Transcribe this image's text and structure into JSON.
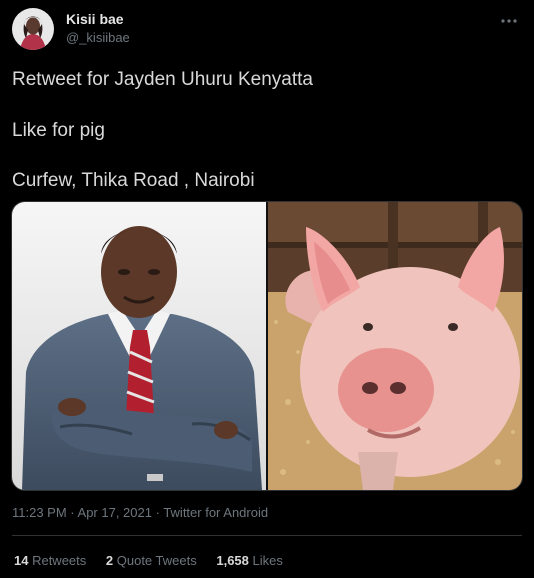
{
  "author": {
    "name": "Kisii bae",
    "handle": "@_kisiibae"
  },
  "menu": {
    "icon": "more-horizontal-icon"
  },
  "content": {
    "line1": "Retweet for Jayden Uhuru Kenyatta",
    "line2": "Like for pig",
    "line3": "Curfew, Thika Road , Nairobi"
  },
  "media": {
    "left": "politician-photo",
    "right": "pig-photo"
  },
  "meta": {
    "time": "11:23 PM",
    "sep1": " · ",
    "date": "Apr 17, 2021",
    "sep2": " · ",
    "client": "Twitter for Android"
  },
  "stats": {
    "retweets": "14",
    "retweets_label": " Retweets",
    "quotes": "2",
    "quotes_label": " Quote Tweets",
    "likes": "1,658",
    "likes_label": " Likes"
  },
  "colors": {
    "background": "#000000",
    "text": "#d9d9d9",
    "secondary": "#6e767d",
    "border": "#2f3336"
  }
}
